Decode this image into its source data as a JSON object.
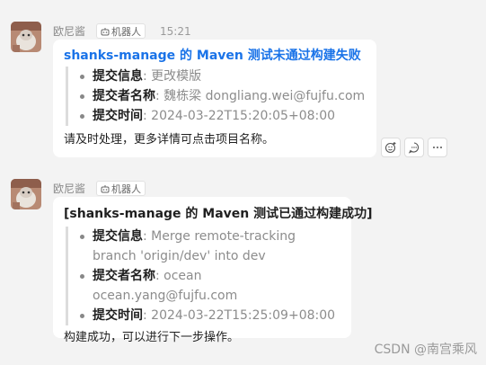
{
  "messages": [
    {
      "sender": "欧尼酱",
      "tag": "机器人",
      "time": "15:21",
      "title": "shanks-manage 的 Maven 测试未通过构建失败",
      "items": [
        {
          "key": "提交信息",
          "value": ": 更改模版"
        },
        {
          "key": "提交者名称",
          "value": ": 魏栋梁 dongliang.wei@fujfu.com"
        },
        {
          "key": "提交时间",
          "value": ": 2024-03-22T15:20:05+08:00"
        }
      ],
      "footer": "请及时处理，更多详情可点击项目名称。"
    },
    {
      "sender": "欧尼酱",
      "tag": "机器人",
      "title": "[shanks-manage 的 Maven 测试已通过构建成功]",
      "items": [
        {
          "key": "提交信息",
          "value": ": Merge remote-tracking branch 'origin/dev' into dev"
        },
        {
          "key": "提交者名称",
          "value": ": ocean ocean.yang@fujfu.com"
        },
        {
          "key": "提交时间",
          "value": ": 2024-03-22T15:25:09+08:00"
        }
      ],
      "footer": "构建成功，可以进行下一步操作。"
    }
  ],
  "actions": [
    "add-reaction-icon",
    "reply-icon",
    "more-icon"
  ],
  "watermark": "CSDN @南宫乘风",
  "colors": {
    "link": "#1a73e8",
    "background": "#f3f3f3",
    "card": "#ffffff"
  }
}
